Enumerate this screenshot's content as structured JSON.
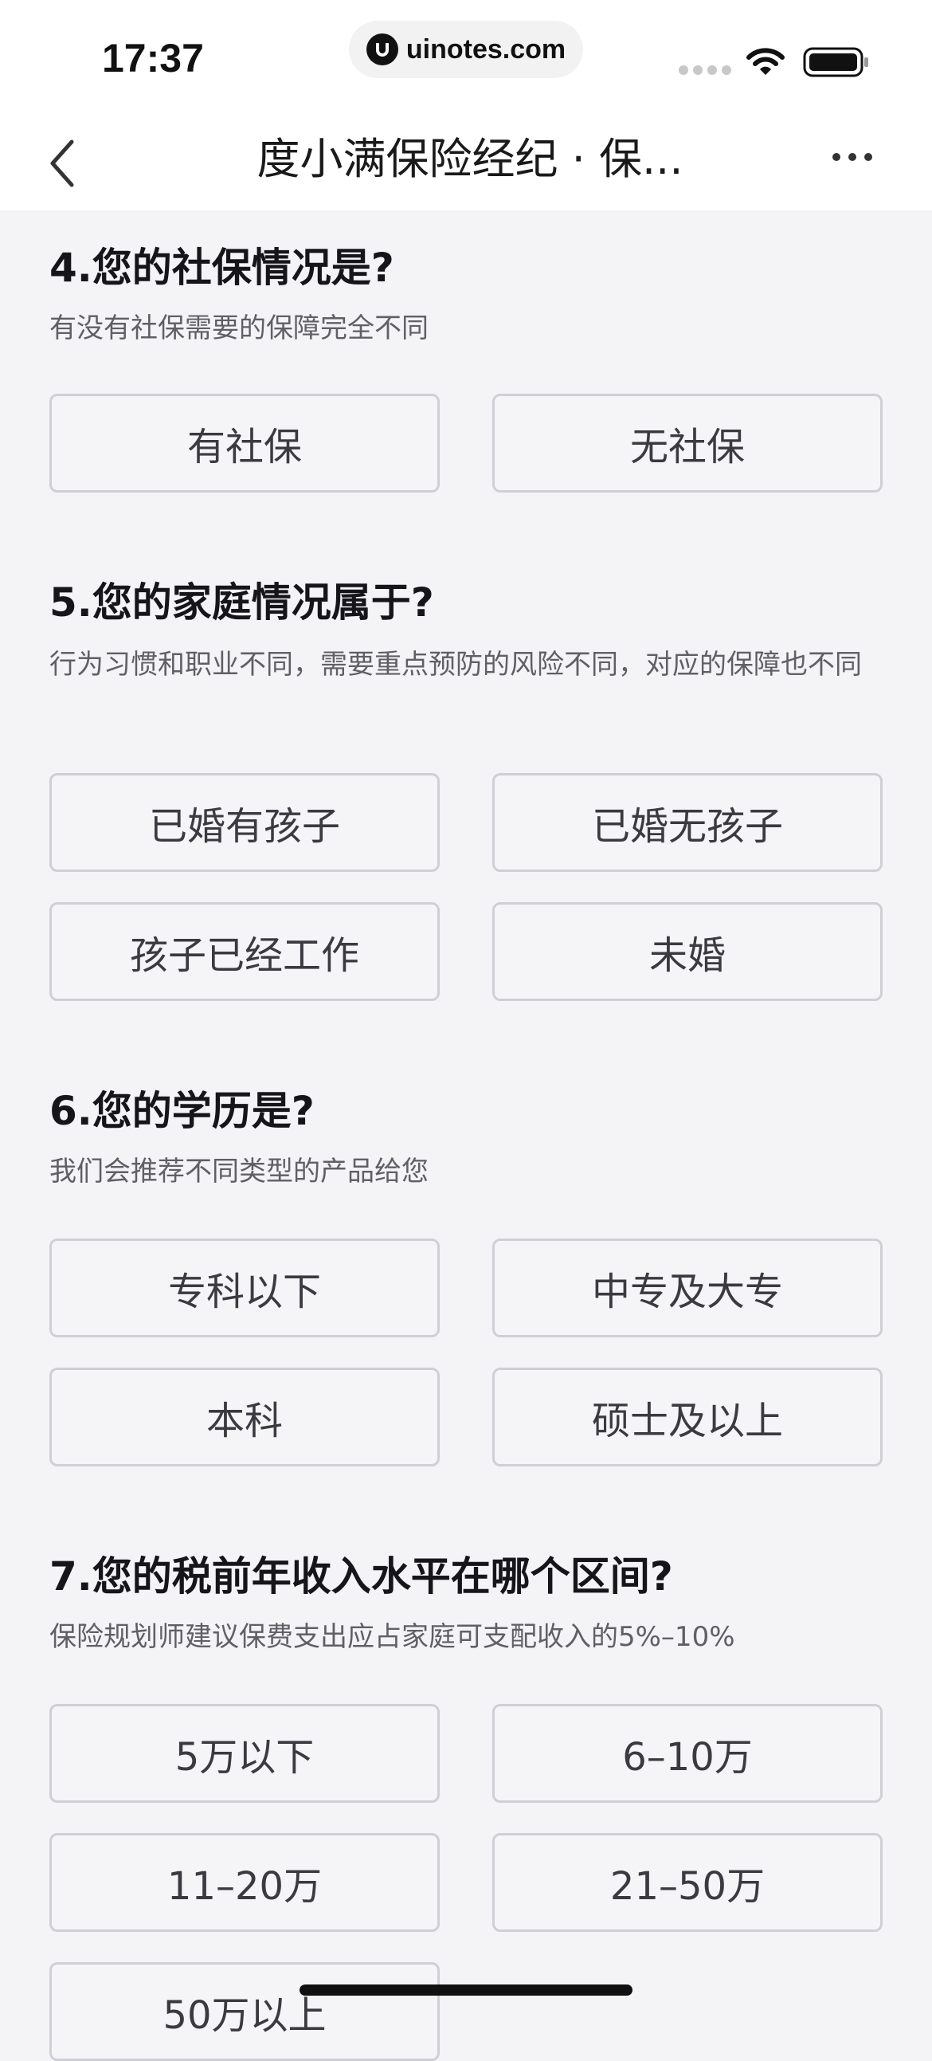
{
  "status_bar": {
    "time": "17:37",
    "url": "uinotes.com"
  },
  "nav": {
    "title": "度小满保险经纪 · 保...",
    "back_icon": "chevron-left-icon",
    "more_icon": "more-horizontal-icon"
  },
  "questions": [
    {
      "title": "4.您的社保情况是?",
      "subtitle": "有没有社保需要的保障完全不同",
      "options": [
        "有社保",
        "无社保"
      ]
    },
    {
      "title": "5.您的家庭情况属于?",
      "subtitle": "行为习惯和职业不同，需要重点预防的风险不同，对应的保障也不同",
      "options": [
        "已婚有孩子",
        "已婚无孩子",
        "孩子已经工作",
        "未婚"
      ]
    },
    {
      "title": "6.您的学历是?",
      "subtitle": "我们会推荐不同类型的产品给您",
      "options": [
        "专科以下",
        "中专及大专",
        "本科",
        "硕士及以上"
      ]
    },
    {
      "title": "7.您的税前年收入水平在哪个区间?",
      "subtitle": "保险规划师建议保费支出应占家庭可支配收入的5%–10%",
      "options": [
        "5万以下",
        "6–10万",
        "11–20万",
        "21–50万",
        "50万以上"
      ]
    }
  ]
}
